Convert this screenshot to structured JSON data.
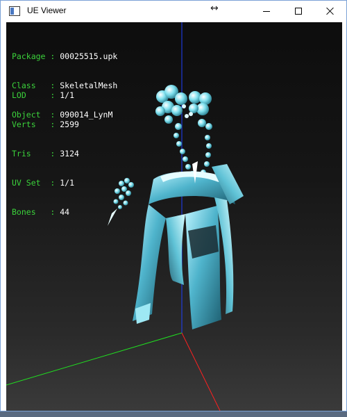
{
  "window": {
    "title": "UE Viewer"
  },
  "icons": {
    "app": "app-icon",
    "resize": "resize-cursor-icon",
    "minimize": "minimize-icon",
    "maximize": "maximize-icon",
    "close": "close-icon"
  },
  "glyphs": {
    "resize": "↔"
  },
  "info_block_1": [
    {
      "key": "Package",
      "value": "00025515.upk"
    },
    {
      "key": "Class  ",
      "value": "SkeletalMesh"
    },
    {
      "key": "Object ",
      "value": "090014_LynM"
    }
  ],
  "info_block_2": [
    {
      "key": "LOD    ",
      "value": "1/1"
    },
    {
      "key": "Verts  ",
      "value": "2599"
    },
    {
      "key": "Tris   ",
      "value": "3124"
    },
    {
      "key": "UV Set ",
      "value": "1/1"
    },
    {
      "key": "Bones  ",
      "value": "44"
    }
  ],
  "colors": {
    "label": "#3bd23b",
    "value": "#ffffff",
    "axis_x": "#ff2020",
    "axis_y": "#20e020",
    "axis_z": "#2040ff",
    "mesh": "#6fd6e6"
  }
}
